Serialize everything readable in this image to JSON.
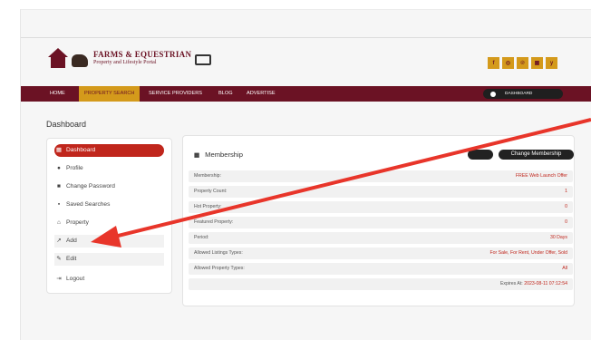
{
  "logo": {
    "title": "FARMS & EQUESTRIAN",
    "subtitle": "Property and Lifestyle Portal"
  },
  "socials": [
    "f",
    "◎",
    "℗",
    "▦",
    "y"
  ],
  "nav": {
    "items": [
      "HOME",
      "PROPERTY SEARCH",
      "SERVICE PROVIDERS",
      "BLOG",
      "ADVERTISE"
    ],
    "active": "PROPERTY SEARCH",
    "dashboard_button": "DASHBOARD"
  },
  "page_title": "Dashboard",
  "sidebar": {
    "items": [
      {
        "icon": "dashboard-icon",
        "label": "Dashboard"
      },
      {
        "icon": "user-icon",
        "label": "Profile"
      },
      {
        "icon": "lock-icon",
        "label": "Change Password"
      },
      {
        "icon": "save-icon",
        "label": "Saved Searches"
      },
      {
        "icon": "home-icon",
        "label": "Property"
      },
      {
        "icon": "external-add-icon",
        "label": "Add"
      },
      {
        "icon": "edit-icon",
        "label": "Edit"
      },
      {
        "icon": "logout-icon",
        "label": "Logout"
      }
    ]
  },
  "membership": {
    "title": "Membership",
    "change_button": "Change Membership",
    "rows": [
      {
        "label": "Membership:",
        "value": "FREE Web Launch Offer"
      },
      {
        "label": "Property Count:",
        "value": "1"
      },
      {
        "label": "Hot Property:",
        "value": "0"
      },
      {
        "label": "Featured Property:",
        "value": "0"
      },
      {
        "label": "Period:",
        "value": "30 Days"
      },
      {
        "label": "Allowed Listings Types:",
        "value": "For Sale, For Rent, Under Offer, Sold"
      },
      {
        "label": "Allowed Property Types:",
        "value": "All"
      }
    ],
    "expires_label": "Expires At:",
    "expires_value": "2023-08-11 07:12:54"
  },
  "colors": {
    "brand": "#6b1224",
    "accent": "#d49a1b",
    "active": "#c0261c",
    "annotation_arrow": "#e8352a"
  }
}
